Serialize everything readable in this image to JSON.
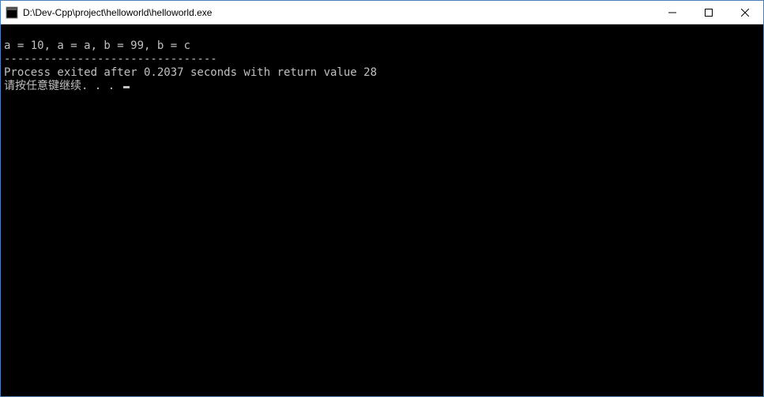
{
  "window": {
    "title": " D:\\Dev-Cpp\\project\\helloworld\\helloworld.exe"
  },
  "console": {
    "line1": "a = 10, a = a, b = 99, b = c",
    "line2": "--------------------------------",
    "line3": "Process exited after 0.2037 seconds with return value 28",
    "line4": "请按任意键继续. . . "
  }
}
